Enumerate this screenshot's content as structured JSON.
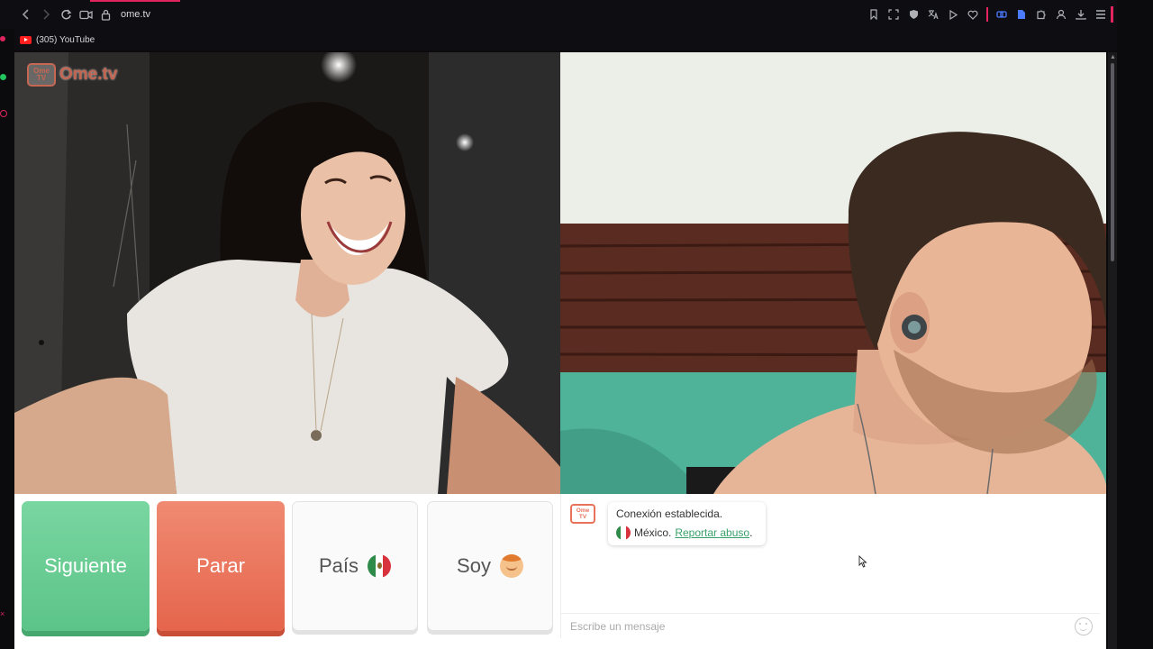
{
  "browser": {
    "url": "ome.tv",
    "bookmark_label": "(305) YouTube"
  },
  "app": {
    "logo_small": "Ome TV",
    "logo_text": "Ome.tv"
  },
  "controls": {
    "next_label": "Siguiente",
    "stop_label": "Parar",
    "country_label": "País",
    "soy_label": "Soy"
  },
  "chat": {
    "status_message": "Conexión establecida.",
    "country": "México.",
    "report_link": "Reportar abuso",
    "report_suffix": ".",
    "input_placeholder": "Escribe un mensaje"
  },
  "colors": {
    "next_green": "#5cc488",
    "stop_red": "#e5654c",
    "link_green": "#3aa06a",
    "brand": "#e8735a"
  },
  "icons": {
    "back": "chevron-left-icon",
    "forward": "chevron-right-icon",
    "reload": "reload-icon",
    "camera": "camera-icon",
    "lock": "lock-icon",
    "flag": "mexico-flag-icon",
    "gender": "boy-emoji-icon",
    "emoji": "smiley-icon"
  }
}
